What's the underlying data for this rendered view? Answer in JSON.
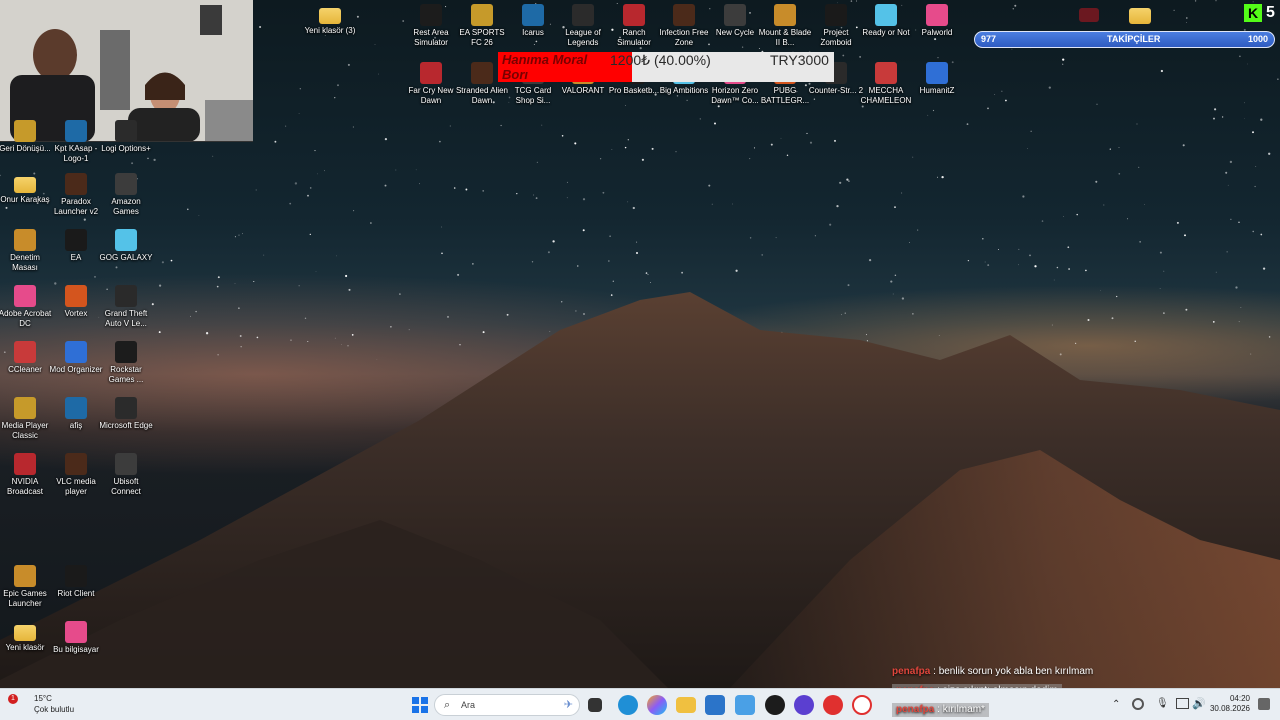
{
  "desktop": {
    "top_row_icons": [
      {
        "label": "Yeni klasör (3)"
      },
      {
        "label": "Rest Area Simulator"
      },
      {
        "label": "EA SPORTS FC 26"
      },
      {
        "label": "Icarus"
      },
      {
        "label": "League of Legends"
      },
      {
        "label": "Ranch Simulator"
      },
      {
        "label": "Infection Free Zone"
      },
      {
        "label": "New Cycle"
      },
      {
        "label": "Mount & Blade II B..."
      },
      {
        "label": "Project Zomboid"
      },
      {
        "label": "Ready or Not"
      },
      {
        "label": "Palworld"
      }
    ],
    "second_row_icons": [
      {
        "label": "Far Cry New Dawn"
      },
      {
        "label": "Stranded Alien Dawn"
      },
      {
        "label": "TCG Card Shop Si..."
      },
      {
        "label": "VALORANT"
      },
      {
        "label": "Pro Basketb..."
      },
      {
        "label": "Big Ambitions"
      },
      {
        "label": "Horizon Zero Dawn™ Co..."
      },
      {
        "label": "PUBG BATTLEGR..."
      },
      {
        "label": "Counter-Str... 2"
      },
      {
        "label": "MECCHA CHAMELEON"
      },
      {
        "label": "HumanitZ"
      }
    ],
    "left_icons": [
      {
        "label": "Geri Dönüşü..."
      },
      {
        "label": "Kpt KAsap - Logo-1"
      },
      {
        "label": "Logi Options+"
      },
      {
        "label": "Onur Karakaş"
      },
      {
        "label": "Paradox Launcher v2"
      },
      {
        "label": "Amazon Games"
      },
      {
        "label": "Denetim Masası"
      },
      {
        "label": "EA"
      },
      {
        "label": "GOG GALAXY"
      },
      {
        "label": "Adobe Acrobat DC"
      },
      {
        "label": "Vortex"
      },
      {
        "label": "Grand Theft Auto V Le..."
      },
      {
        "label": "CCleaner"
      },
      {
        "label": "Mod Organizer"
      },
      {
        "label": "Rockstar Games ..."
      },
      {
        "label": "Media Player Classic"
      },
      {
        "label": "afiş"
      },
      {
        "label": "Microsoft Edge"
      },
      {
        "label": "NVIDIA Broadcast"
      },
      {
        "label": "VLC media player"
      },
      {
        "label": "Ubisoft Connect"
      },
      {
        "label": "Epic Games Launcher"
      },
      {
        "label": "Riot Client"
      },
      {
        "label": "Yeni klasör"
      },
      {
        "label": "Bu bilgisayar"
      }
    ]
  },
  "overlay": {
    "goal": {
      "title": "Hanıma Moral Borı",
      "amount": "1200₺ (40.00%)",
      "target": "TRY3000",
      "progress_fraction": 0.4
    },
    "followers": {
      "current": "977",
      "label": "TAKİPÇİLER",
      "goal": "1000"
    },
    "kick_badge": "5",
    "chat": [
      {
        "user": "penafpa",
        "message": "benlik sorun yok abla ben kırılmam"
      },
      {
        "user": "penafpa",
        "message": "size sıkıntı olmasın dedim"
      },
      {
        "user": "penafpa",
        "message": "kırılmam*"
      }
    ]
  },
  "taskbar": {
    "weather_temp": "15°C",
    "weather_desc": "Çok bulutlu",
    "weather_badge": "1",
    "search_placeholder": "Ara",
    "time": "04:20",
    "date": "30.08.2026"
  },
  "colors": {
    "goal_fill": "#ff0000",
    "followers_bar": "#3a6bd0",
    "chat_user": "#e0463c",
    "kick_green": "#53fc18"
  }
}
